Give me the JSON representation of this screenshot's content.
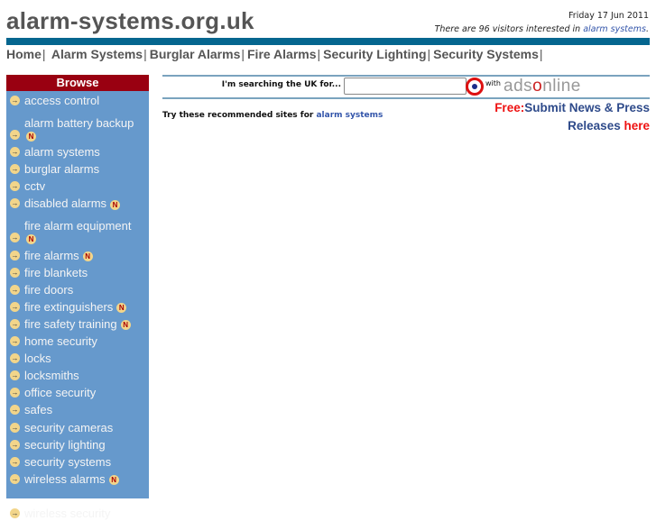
{
  "header": {
    "site_title": "alarm-systems.org.uk",
    "date": "Friday 17 Jun 2011",
    "visitors_prefix": "There are 96 visitors interested in ",
    "visitors_link": "alarm systems",
    "visitors_suffix": "."
  },
  "topnav": {
    "items": [
      {
        "label": "Home"
      },
      {
        "label": "Alarm Systems"
      },
      {
        "label": "Burglar Alarms"
      },
      {
        "label": "Fire Alarms"
      },
      {
        "label": "Security Lighting"
      },
      {
        "label": "Security Systems"
      }
    ],
    "separator": "|"
  },
  "sidebar": {
    "title": "Browse",
    "arrow_icon": "→",
    "new_badge": "N",
    "items": [
      {
        "label": "access control",
        "new": false
      },
      {
        "label": "alarm battery backup",
        "new": true
      },
      {
        "label": "alarm systems",
        "new": false
      },
      {
        "label": "burglar alarms",
        "new": false
      },
      {
        "label": "cctv",
        "new": false
      },
      {
        "label": "disabled alarms",
        "new": true
      },
      {
        "label": "fire alarm equipment",
        "new": true
      },
      {
        "label": "fire alarms",
        "new": true
      },
      {
        "label": "fire blankets",
        "new": false
      },
      {
        "label": "fire doors",
        "new": false
      },
      {
        "label": "fire extinguishers",
        "new": true
      },
      {
        "label": "fire safety training",
        "new": true
      },
      {
        "label": "home security",
        "new": false
      },
      {
        "label": "locks",
        "new": false
      },
      {
        "label": "locksmiths",
        "new": false
      },
      {
        "label": "office security",
        "new": false
      },
      {
        "label": "safes",
        "new": false
      },
      {
        "label": "security cameras",
        "new": false
      },
      {
        "label": "security lighting",
        "new": false
      },
      {
        "label": "security systems",
        "new": false
      },
      {
        "label": "wireless alarms",
        "new": true
      },
      {
        "label": "wireless security",
        "new": false
      }
    ]
  },
  "search": {
    "label": "I'm searching the UK for...",
    "value": "",
    "placeholder": "",
    "with_label": "with",
    "logo_prefix": "ads",
    "logo_o": "o",
    "logo_suffix": "nline"
  },
  "main": {
    "recommend_prefix": "Try these recommended sites for ",
    "recommend_link": "alarm systems"
  },
  "promo": {
    "free": "Free:",
    "line1": "Submit News & Press",
    "line2": "Releases ",
    "here": "here"
  },
  "colors": {
    "brand_bar": "#05668f",
    "sidebar_bg": "#6699cc",
    "sidebar_header": "#990011",
    "link_blue": "#3355aa",
    "promo_red": "#ee1111"
  }
}
